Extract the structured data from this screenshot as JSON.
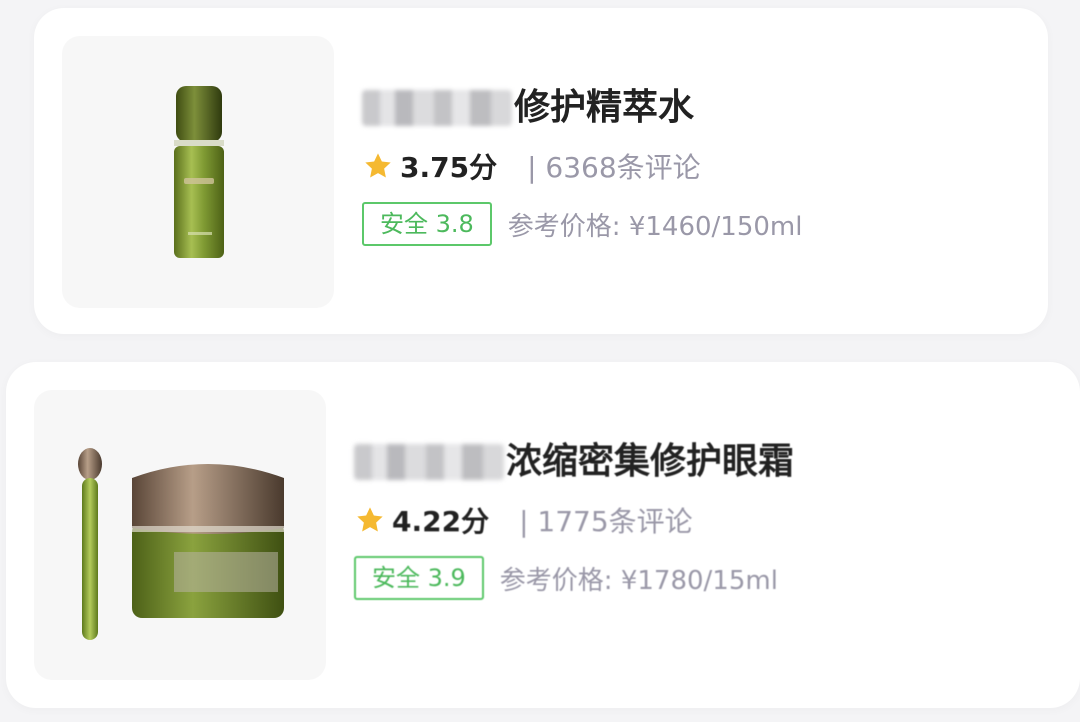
{
  "products": [
    {
      "title_suffix": "修护精萃水",
      "score": "3.75分",
      "comments": "| 6368条评论",
      "safety": "安全 3.8",
      "price": "参考价格: ¥1460/150ml",
      "image_icon": "toner-bottle-image"
    },
    {
      "title_suffix": "浓缩密集修护眼霜",
      "score": "4.22分",
      "comments": "| 1775条评论",
      "safety": "安全 3.9",
      "price": "参考价格: ¥1780/15ml",
      "image_icon": "eye-cream-jar-image"
    }
  ],
  "colors": {
    "star": "#f5b931",
    "safe_green": "#5cc86a",
    "muted": "#9a98a8",
    "product_green": "#6e8a2c"
  }
}
